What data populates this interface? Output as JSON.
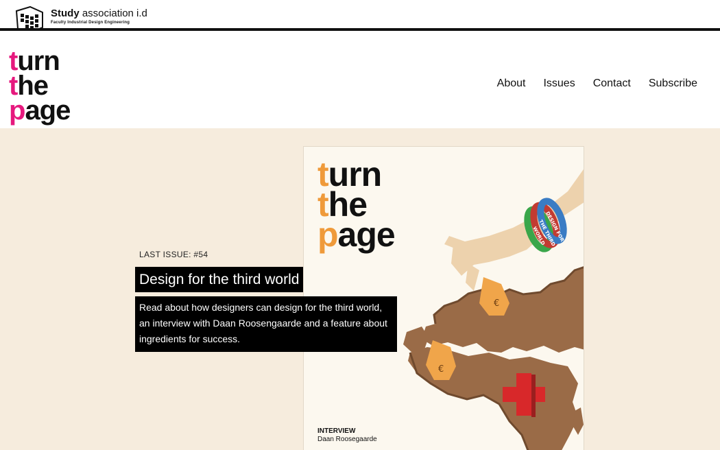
{
  "association": {
    "name_bold": "Study",
    "name_rest": "association i.d",
    "subtitle": "Faculty Industrial Design Engineering"
  },
  "brand": {
    "line1_accent": "t",
    "line1_rest": "urn",
    "line2_accent": "t",
    "line2_rest": "he",
    "line3_accent": "p",
    "line3_rest": "age"
  },
  "nav": {
    "items": [
      {
        "label": "About"
      },
      {
        "label": "Issues"
      },
      {
        "label": "Contact"
      },
      {
        "label": "Subscribe"
      }
    ]
  },
  "hero": {
    "issue_label": "LAST ISSUE: #54",
    "title": "Design for the third world",
    "description": "Read about how designers can design for the third world, an interview with Daan Roosengaarde and a feature about ingredients for success."
  },
  "cover": {
    "title_line1_accent": "t",
    "title_line1_rest": "urn",
    "title_line2_accent": "t",
    "title_line2_rest": "he",
    "title_line3_accent": "p",
    "title_line3_rest": "age",
    "wristband_text_1": "DESIGN FOR",
    "wristband_text_2": "THE THIRD",
    "wristband_text_3": "WORLD",
    "kicker": "INTERVIEW",
    "name": "Daan Roosegaarde"
  },
  "colors": {
    "brand_accent": "#e6197e",
    "cover_accent": "#ef9a3a",
    "hero_background": "#f6ecdd"
  }
}
